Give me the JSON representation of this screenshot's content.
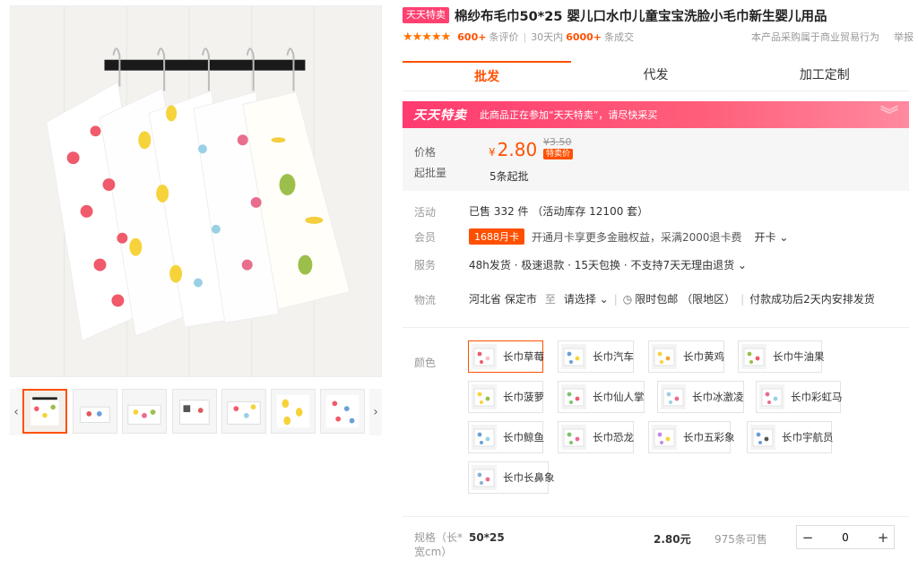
{
  "title": {
    "badge": "天天特卖",
    "text": "棉纱布毛巾50*25 婴儿口水巾儿童宝宝洗脸小毛巾新生婴儿用品"
  },
  "rating": {
    "stars": "★★★★★",
    "reviews_count": "600+",
    "reviews_label": "条评价",
    "period": "30天内",
    "deals_count": "6000+",
    "deals_label": "条成交",
    "right_note": "本产品采购属于商业贸易行为",
    "report": "举报"
  },
  "tabs": [
    "批发",
    "代发",
    "加工定制"
  ],
  "promo": {
    "title": "天天特卖",
    "text": "此商品正在参加“天天特卖”，请尽快采买"
  },
  "price": {
    "label": "价格",
    "currency": "¥",
    "value": "2.80",
    "old": "¥3.50",
    "tag": "特卖价",
    "moq_label": "起批量",
    "moq": "5条起批"
  },
  "info": {
    "activity_label": "活动",
    "activity": "已售 332 件 （活动库存 12100 套）",
    "member_label": "会员",
    "member_badge": "1688月卡",
    "member_text": "开通月卡享更多金融权益，采满2000退卡费",
    "member_link": "开卡 ⌄",
    "service_label": "服务",
    "service": "48h发货 · 极速退款 · 15天包换 · 不支持7天无理由退货 ⌄",
    "logistics_label": "物流",
    "origin": "河北省 保定市",
    "to": "至",
    "select": "请选择 ⌄",
    "shipping": "限时包邮 （限地区）",
    "dispatch": "付款成功后2天内安排发货"
  },
  "colors": {
    "label": "颜色",
    "options": [
      "长巾草莓",
      "长巾汽车",
      "长巾黄鸡",
      "长巾牛油果",
      "长巾菠萝",
      "长巾仙人掌",
      "长巾冰激凌",
      "长巾彩虹马",
      "长巾鲸鱼",
      "长巾恐龙",
      "长巾五彩象",
      "长巾宇航员",
      "长巾长鼻象"
    ],
    "selected": "长巾草莓"
  },
  "spec": {
    "label": "规格（长*宽cm）",
    "name": "50*25",
    "price": "2.80元",
    "stock": "975条可售",
    "minus": "−",
    "quantity": "0",
    "plus": "+"
  },
  "gallery": {
    "thumb_count": 7,
    "prev": "‹",
    "next": "›"
  },
  "colors_theme": {
    "accent": "#ff5000",
    "promo": "#ff3a6f",
    "badge": "#ff4070"
  }
}
